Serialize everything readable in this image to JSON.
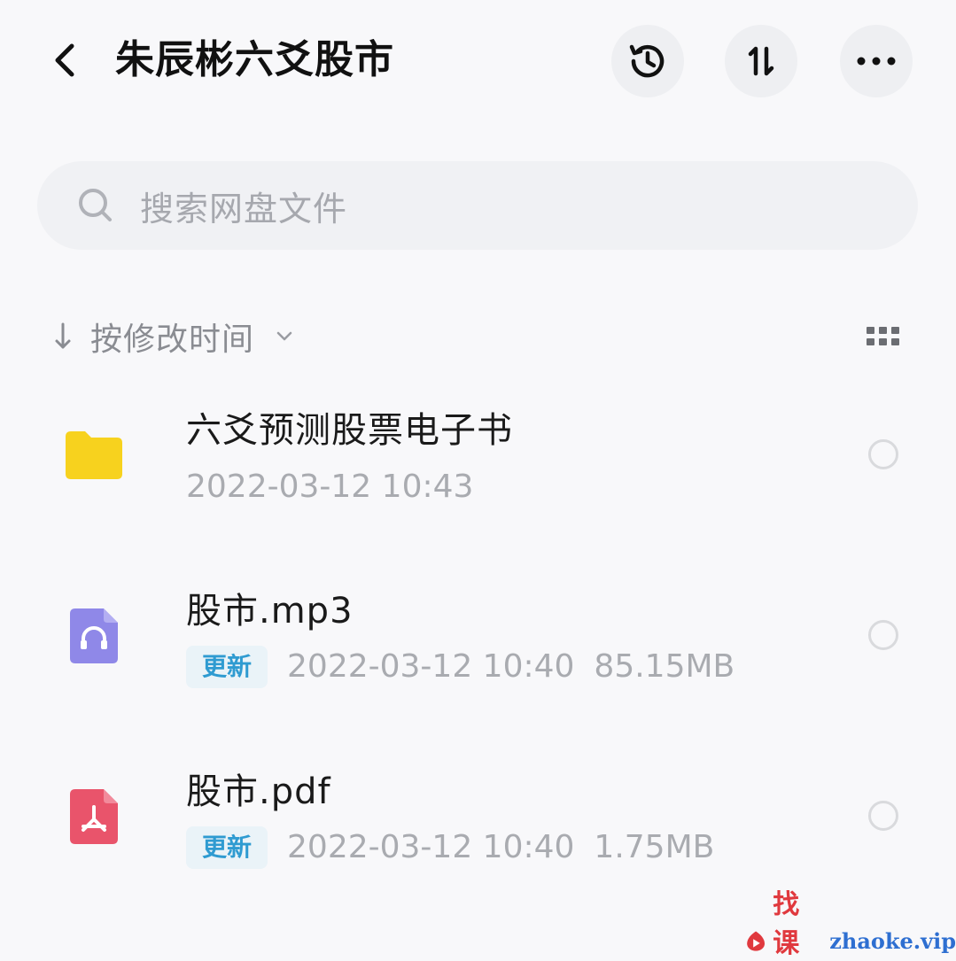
{
  "header": {
    "title": "朱辰彬六爻股市",
    "back_icon": "chevron-left-icon",
    "history_icon": "history-icon",
    "sort_icon": "sort-arrows-icon",
    "more_icon": "more-dots-icon"
  },
  "search": {
    "placeholder": "搜索网盘文件",
    "icon": "search-icon"
  },
  "sortbar": {
    "label": "按修改时间",
    "direction_icon": "arrow-down-icon",
    "caret_icon": "chevron-down-icon",
    "view_toggle_icon": "grid-view-icon"
  },
  "files": [
    {
      "name": "六爻预测股票电子书",
      "type": "folder",
      "icon": "folder-icon",
      "badge": "",
      "datetime": "2022-03-12  10:43",
      "size": ""
    },
    {
      "name": "股市.mp3",
      "type": "audio",
      "icon": "audio-file-icon",
      "badge": "更新",
      "datetime": "2022-03-12  10:40",
      "size": "85.15MB"
    },
    {
      "name": "股市.pdf",
      "type": "pdf",
      "icon": "pdf-file-icon",
      "badge": "更新",
      "datetime": "2022-03-12  10:40",
      "size": "1.75MB"
    }
  ],
  "colors": {
    "folder": "#f7d21e",
    "audio": "#8f88e8",
    "pdf": "#e9546b",
    "badge_text": "#2f9bd1",
    "badge_bg": "#eaf3f8"
  },
  "watermark": {
    "cn": "找课网",
    "en": "zhaoke.vip",
    "icon": "play-logo-icon"
  }
}
